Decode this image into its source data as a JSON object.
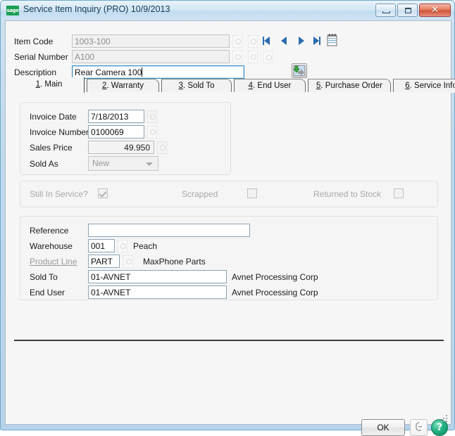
{
  "window": {
    "title": "Service Item Inquiry (PRO) 10/9/2013",
    "logo_text": "sage",
    "logo_icon": "sage-logo-icon",
    "minimize_label": "Minimize",
    "maximize_label": "Maximize",
    "close_label": "Close",
    "close_glyph": "✕"
  },
  "header": {
    "item_code": {
      "label": "Item Code",
      "value": "1003-100"
    },
    "serial_number": {
      "label": "Serial Number",
      "value": "A100"
    },
    "description": {
      "label": "Description",
      "value": "Rear Camera 100"
    },
    "nav": {
      "first_label": "First",
      "prev_label": "Previous",
      "next_label": "Next",
      "last_label": "Last",
      "memo_label": "Memo"
    },
    "new_button_label": "New Item"
  },
  "tabs": [
    {
      "num": "1",
      "label": "Main",
      "active": true
    },
    {
      "num": "2",
      "label": "Warranty",
      "active": false
    },
    {
      "num": "3",
      "label": "Sold To",
      "active": false
    },
    {
      "num": "4",
      "label": "End User",
      "active": false
    },
    {
      "num": "5",
      "label": "Purchase Order",
      "active": false
    },
    {
      "num": "6",
      "label": "Service Info",
      "active": false
    }
  ],
  "invoice_panel": {
    "invoice_date": {
      "label": "Invoice Date",
      "value": "7/18/2013"
    },
    "invoice_number": {
      "label": "Invoice Number",
      "value": "0100069"
    },
    "sales_price": {
      "label": "Sales Price",
      "value": "49.950"
    },
    "sold_as": {
      "label": "Sold As",
      "value": "New"
    }
  },
  "status_panel": {
    "still_in_service": {
      "label": "Still In Service?",
      "checked": true
    },
    "scrapped": {
      "label": "Scrapped",
      "checked": false
    },
    "returned_to_stock": {
      "label": "Returned to Stock",
      "checked": false
    }
  },
  "detail_panel": {
    "reference": {
      "label": "Reference",
      "value": ""
    },
    "warehouse": {
      "label": "Warehouse",
      "value": "001",
      "description": "Peach"
    },
    "product_line": {
      "label": "Product Line",
      "value": "PART",
      "description": "MaxPhone Parts"
    },
    "sold_to": {
      "label": "Sold To",
      "value": "01-AVNET",
      "description": "Avnet Processing Corp"
    },
    "end_user": {
      "label": "End User",
      "value": "01-AVNET",
      "description": "Avnet Processing Corp"
    }
  },
  "footer": {
    "ok_label": "OK",
    "ok_label_html": "<u>O</u>K",
    "memo_label": "Memo",
    "help_label": "?"
  },
  "colors": {
    "frame": "#b7d3ea",
    "client_bg": "#f6f6f6",
    "accent_green": "#1c9e54",
    "close_red": "#d0543a",
    "focus_blue": "#3c8ac4"
  }
}
